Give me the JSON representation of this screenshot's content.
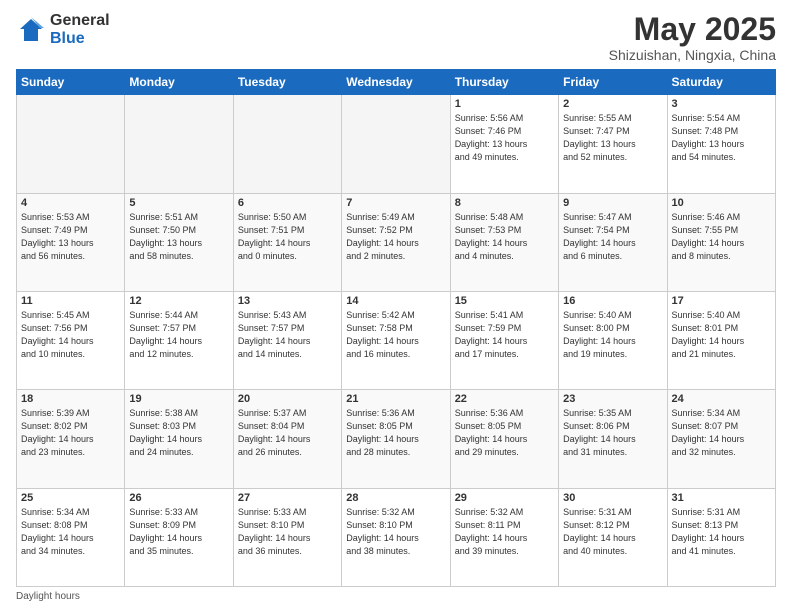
{
  "header": {
    "logo_general": "General",
    "logo_blue": "Blue",
    "month_title": "May 2025",
    "location": "Shizuishan, Ningxia, China"
  },
  "footer": {
    "note": "Daylight hours"
  },
  "days_of_week": [
    "Sunday",
    "Monday",
    "Tuesday",
    "Wednesday",
    "Thursday",
    "Friday",
    "Saturday"
  ],
  "weeks": [
    [
      {
        "day": "",
        "info": ""
      },
      {
        "day": "",
        "info": ""
      },
      {
        "day": "",
        "info": ""
      },
      {
        "day": "",
        "info": ""
      },
      {
        "day": "1",
        "info": "Sunrise: 5:56 AM\nSunset: 7:46 PM\nDaylight: 13 hours\nand 49 minutes."
      },
      {
        "day": "2",
        "info": "Sunrise: 5:55 AM\nSunset: 7:47 PM\nDaylight: 13 hours\nand 52 minutes."
      },
      {
        "day": "3",
        "info": "Sunrise: 5:54 AM\nSunset: 7:48 PM\nDaylight: 13 hours\nand 54 minutes."
      }
    ],
    [
      {
        "day": "4",
        "info": "Sunrise: 5:53 AM\nSunset: 7:49 PM\nDaylight: 13 hours\nand 56 minutes."
      },
      {
        "day": "5",
        "info": "Sunrise: 5:51 AM\nSunset: 7:50 PM\nDaylight: 13 hours\nand 58 minutes."
      },
      {
        "day": "6",
        "info": "Sunrise: 5:50 AM\nSunset: 7:51 PM\nDaylight: 14 hours\nand 0 minutes."
      },
      {
        "day": "7",
        "info": "Sunrise: 5:49 AM\nSunset: 7:52 PM\nDaylight: 14 hours\nand 2 minutes."
      },
      {
        "day": "8",
        "info": "Sunrise: 5:48 AM\nSunset: 7:53 PM\nDaylight: 14 hours\nand 4 minutes."
      },
      {
        "day": "9",
        "info": "Sunrise: 5:47 AM\nSunset: 7:54 PM\nDaylight: 14 hours\nand 6 minutes."
      },
      {
        "day": "10",
        "info": "Sunrise: 5:46 AM\nSunset: 7:55 PM\nDaylight: 14 hours\nand 8 minutes."
      }
    ],
    [
      {
        "day": "11",
        "info": "Sunrise: 5:45 AM\nSunset: 7:56 PM\nDaylight: 14 hours\nand 10 minutes."
      },
      {
        "day": "12",
        "info": "Sunrise: 5:44 AM\nSunset: 7:57 PM\nDaylight: 14 hours\nand 12 minutes."
      },
      {
        "day": "13",
        "info": "Sunrise: 5:43 AM\nSunset: 7:57 PM\nDaylight: 14 hours\nand 14 minutes."
      },
      {
        "day": "14",
        "info": "Sunrise: 5:42 AM\nSunset: 7:58 PM\nDaylight: 14 hours\nand 16 minutes."
      },
      {
        "day": "15",
        "info": "Sunrise: 5:41 AM\nSunset: 7:59 PM\nDaylight: 14 hours\nand 17 minutes."
      },
      {
        "day": "16",
        "info": "Sunrise: 5:40 AM\nSunset: 8:00 PM\nDaylight: 14 hours\nand 19 minutes."
      },
      {
        "day": "17",
        "info": "Sunrise: 5:40 AM\nSunset: 8:01 PM\nDaylight: 14 hours\nand 21 minutes."
      }
    ],
    [
      {
        "day": "18",
        "info": "Sunrise: 5:39 AM\nSunset: 8:02 PM\nDaylight: 14 hours\nand 23 minutes."
      },
      {
        "day": "19",
        "info": "Sunrise: 5:38 AM\nSunset: 8:03 PM\nDaylight: 14 hours\nand 24 minutes."
      },
      {
        "day": "20",
        "info": "Sunrise: 5:37 AM\nSunset: 8:04 PM\nDaylight: 14 hours\nand 26 minutes."
      },
      {
        "day": "21",
        "info": "Sunrise: 5:36 AM\nSunset: 8:05 PM\nDaylight: 14 hours\nand 28 minutes."
      },
      {
        "day": "22",
        "info": "Sunrise: 5:36 AM\nSunset: 8:05 PM\nDaylight: 14 hours\nand 29 minutes."
      },
      {
        "day": "23",
        "info": "Sunrise: 5:35 AM\nSunset: 8:06 PM\nDaylight: 14 hours\nand 31 minutes."
      },
      {
        "day": "24",
        "info": "Sunrise: 5:34 AM\nSunset: 8:07 PM\nDaylight: 14 hours\nand 32 minutes."
      }
    ],
    [
      {
        "day": "25",
        "info": "Sunrise: 5:34 AM\nSunset: 8:08 PM\nDaylight: 14 hours\nand 34 minutes."
      },
      {
        "day": "26",
        "info": "Sunrise: 5:33 AM\nSunset: 8:09 PM\nDaylight: 14 hours\nand 35 minutes."
      },
      {
        "day": "27",
        "info": "Sunrise: 5:33 AM\nSunset: 8:10 PM\nDaylight: 14 hours\nand 36 minutes."
      },
      {
        "day": "28",
        "info": "Sunrise: 5:32 AM\nSunset: 8:10 PM\nDaylight: 14 hours\nand 38 minutes."
      },
      {
        "day": "29",
        "info": "Sunrise: 5:32 AM\nSunset: 8:11 PM\nDaylight: 14 hours\nand 39 minutes."
      },
      {
        "day": "30",
        "info": "Sunrise: 5:31 AM\nSunset: 8:12 PM\nDaylight: 14 hours\nand 40 minutes."
      },
      {
        "day": "31",
        "info": "Sunrise: 5:31 AM\nSunset: 8:13 PM\nDaylight: 14 hours\nand 41 minutes."
      }
    ]
  ]
}
